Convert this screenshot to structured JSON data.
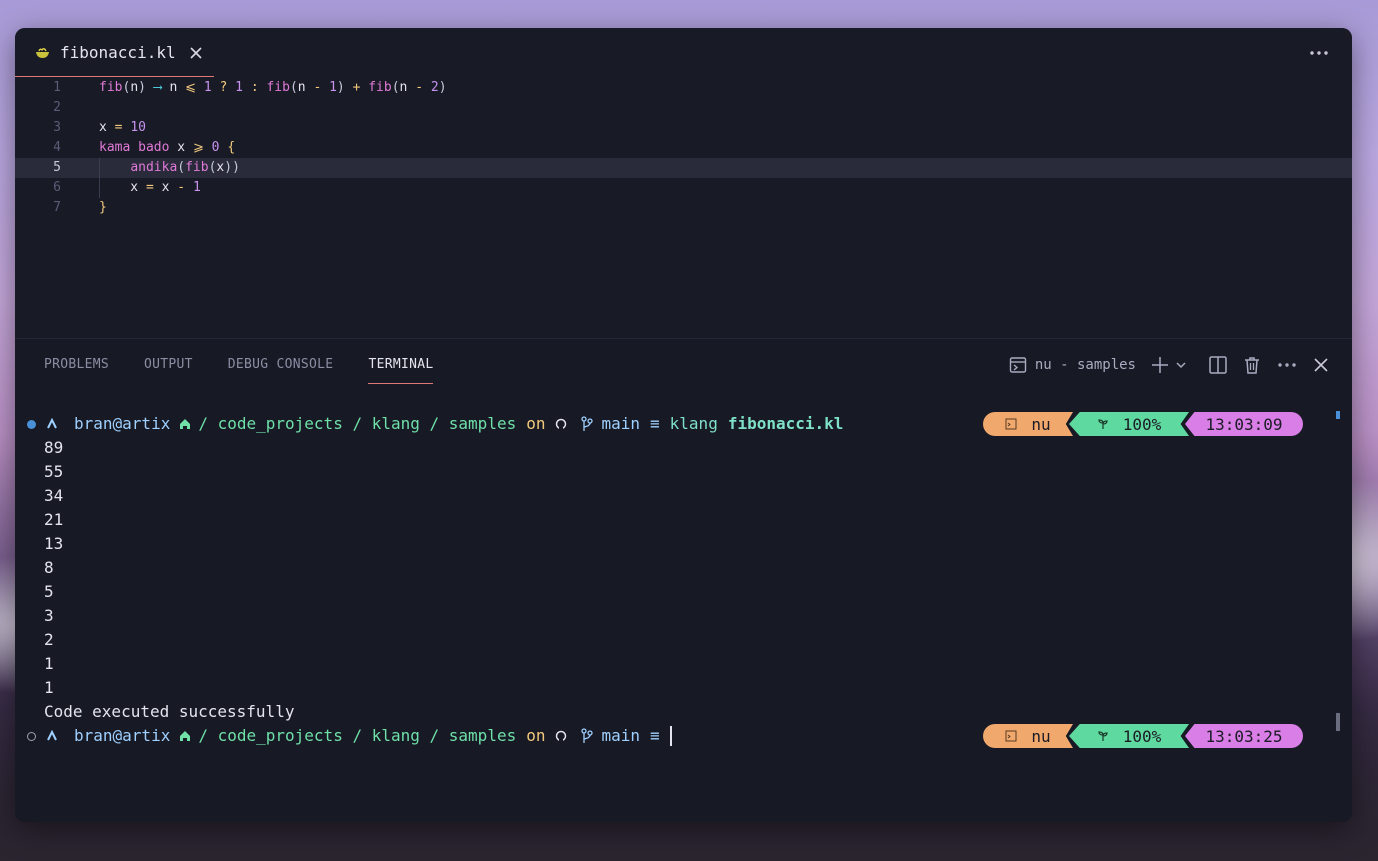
{
  "tab": {
    "filename": "fibonacci.kl"
  },
  "editor": {
    "line_numbers": [
      "1",
      "2",
      "3",
      "4",
      "5",
      "6",
      "7"
    ],
    "lines": [
      [
        [
          "f",
          "fib"
        ],
        [
          "p",
          "("
        ],
        [
          "v",
          "n"
        ],
        [
          "p",
          ")"
        ],
        [
          "v",
          " "
        ],
        [
          "o",
          "⟶"
        ],
        [
          "v",
          " n "
        ],
        [
          "y",
          "⩽"
        ],
        [
          "v",
          " "
        ],
        [
          "n",
          "1"
        ],
        [
          "v",
          " "
        ],
        [
          "y",
          "?"
        ],
        [
          "v",
          " "
        ],
        [
          "n",
          "1"
        ],
        [
          "v",
          " "
        ],
        [
          "y",
          ":"
        ],
        [
          "v",
          " "
        ],
        [
          "f",
          "fib"
        ],
        [
          "p",
          "("
        ],
        [
          "v",
          "n "
        ],
        [
          "y",
          "-"
        ],
        [
          "v",
          " "
        ],
        [
          "n",
          "1"
        ],
        [
          "p",
          ")"
        ],
        [
          "v",
          " "
        ],
        [
          "y",
          "+"
        ],
        [
          "v",
          " "
        ],
        [
          "f",
          "fib"
        ],
        [
          "p",
          "("
        ],
        [
          "v",
          "n "
        ],
        [
          "y",
          "-"
        ],
        [
          "v",
          " "
        ],
        [
          "n",
          "2"
        ],
        [
          "p",
          ")"
        ]
      ],
      [],
      [
        [
          "v",
          "x "
        ],
        [
          "y",
          "="
        ],
        [
          "v",
          " "
        ],
        [
          "n",
          "10"
        ]
      ],
      [
        [
          "k",
          "kama bado"
        ],
        [
          "v",
          " x "
        ],
        [
          "y",
          "⩾"
        ],
        [
          "v",
          " "
        ],
        [
          "n",
          "0"
        ],
        [
          "v",
          " "
        ],
        [
          "y",
          "{"
        ]
      ],
      [
        [
          "v",
          "    "
        ],
        [
          "f",
          "andika"
        ],
        [
          "p",
          "("
        ],
        [
          "f",
          "fib"
        ],
        [
          "p",
          "("
        ],
        [
          "v",
          "x"
        ],
        [
          "p",
          "))"
        ]
      ],
      [
        [
          "v",
          "    x "
        ],
        [
          "y",
          "="
        ],
        [
          "v",
          " x "
        ],
        [
          "y",
          "-"
        ],
        [
          "v",
          " "
        ],
        [
          "n",
          "1"
        ]
      ],
      [
        [
          "y",
          "}"
        ]
      ]
    ]
  },
  "panel": {
    "tabs": [
      "PROBLEMS",
      "OUTPUT",
      "DEBUG CONSOLE",
      "TERMINAL"
    ],
    "active_tab": "TERMINAL",
    "terminal_name": "nu - samples"
  },
  "terminal": {
    "prompt1": {
      "user": "bran@artix",
      "path": "/ code_projects / klang / samples",
      "on": "on",
      "branch": "main",
      "branch_status": "≡",
      "command": "klang",
      "arg": "fibonacci.kl",
      "shell": "nu",
      "battery": "100%",
      "time": "13:03:09"
    },
    "output": [
      "89",
      "55",
      "34",
      "21",
      "13",
      "8",
      "5",
      "3",
      "2",
      "1",
      "1",
      "Code executed successfully"
    ],
    "prompt2": {
      "user": "bran@artix",
      "path": "/ code_projects / klang / samples",
      "on": "on",
      "branch": "main",
      "branch_status": "≡",
      "shell": "nu",
      "battery": "100%",
      "time": "13:03:25"
    }
  },
  "icons": {
    "tab": "bowl-icon",
    "terminal": "terminal-icon",
    "shell_prompt": "caret-icon",
    "home": "home-icon",
    "git": "github-icon",
    "branch": "branch-icon",
    "battery": "leaf-icon"
  },
  "colors": {
    "accent": "#e0787a",
    "window_bg": "#181a26",
    "seg_shell": "#f0a86d",
    "seg_battery": "#5ed9a0",
    "seg_time": "#d87ee6"
  }
}
